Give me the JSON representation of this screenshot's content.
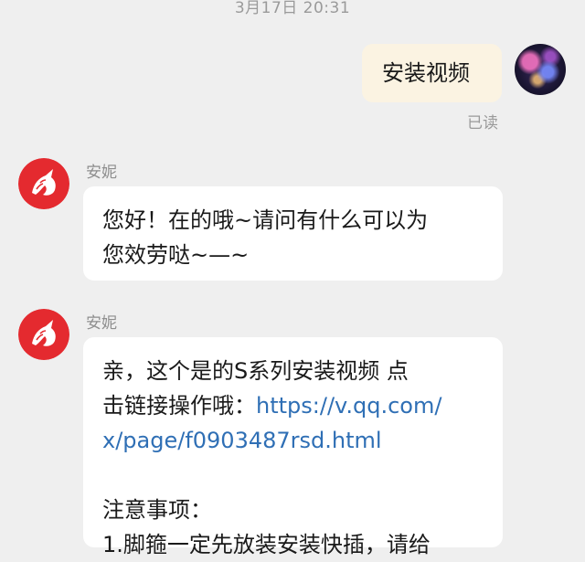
{
  "chat": {
    "timestamp": "3月17日 20:31",
    "messages": [
      {
        "direction": "outgoing",
        "text": "安装视频",
        "status": "已读"
      },
      {
        "direction": "incoming",
        "sender": "安妮",
        "lines": [
          "您好！在的哦~请问有什么可以为",
          "您效劳哒~—~"
        ]
      },
      {
        "direction": "incoming",
        "sender": "安妮",
        "line1": "亲，这个是的S系列安装视频 点",
        "line2_prefix": "击链接操作哦：",
        "link_part1": "https://v.qq.com/",
        "link_part2": "x/page/f0903487rsd.html",
        "notes_title": "注意事项：",
        "cut_line": "1.脚箍一定先放装安装快插，请给"
      }
    ]
  },
  "colors": {
    "background": "#efefef",
    "outgoing_bubble": "#fbf3e2",
    "incoming_bubble": "#ffffff",
    "link": "#2f6fb5",
    "brand_red": "#e42a2f"
  },
  "icons": {
    "user_avatar": "galaxy-avatar",
    "agent_avatar": "unicorn-logo-icon"
  }
}
